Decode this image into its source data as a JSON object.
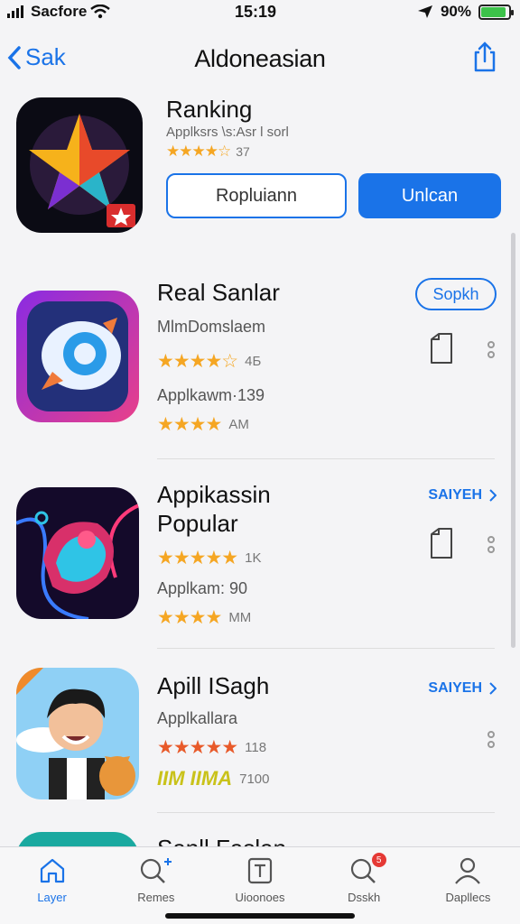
{
  "status": {
    "carrier": "Sacfore",
    "time": "15:19",
    "battery": "90%",
    "battery_level": 0.9
  },
  "nav": {
    "back_label": "Sak",
    "title": "Aldoneasian"
  },
  "hero": {
    "title": "Ranking",
    "subtitle": "Applksrs \\s:Asr l sorl",
    "rating_text": "37",
    "button_outline": "Ropluiann",
    "button_fill": "Unlcan"
  },
  "rows": [
    {
      "title": "Real Sanlar",
      "line1": "MlmDomslaem",
      "stars1": "4Б",
      "line2": "Applkawm·139",
      "stars2": "AM",
      "action": "Sopkh",
      "action_type": "pill"
    },
    {
      "title": "Appikassin Popular",
      "line1": "",
      "stars1": "1K",
      "line2": "Applkam: 90",
      "stars2": "MM",
      "action": "SAIYEH",
      "action_type": "link"
    },
    {
      "title": "Apill ISagh",
      "line1": "Applkallara",
      "stars1": "118",
      "line2": "",
      "stars2": "7100",
      "action": "SAIYEH",
      "action_type": "link"
    },
    {
      "title": "Sanll Faslan",
      "line1": "",
      "stars1": "",
      "line2": "",
      "stars2": "",
      "action": "",
      "action_type": "link"
    }
  ],
  "row3_badge_text": "IIM IIMA",
  "tabs": [
    {
      "label": "Layer",
      "icon": "home-icon"
    },
    {
      "label": "Remes",
      "icon": "search-plus-icon"
    },
    {
      "label": "Uioonoes",
      "icon": "text-box-icon"
    },
    {
      "label": "Dsskh",
      "icon": "search-badge-icon",
      "badge": "5"
    },
    {
      "label": "Dapllecs",
      "icon": "person-icon"
    }
  ],
  "colors": {
    "accent": "#1a73e8",
    "star": "#f5a623"
  }
}
